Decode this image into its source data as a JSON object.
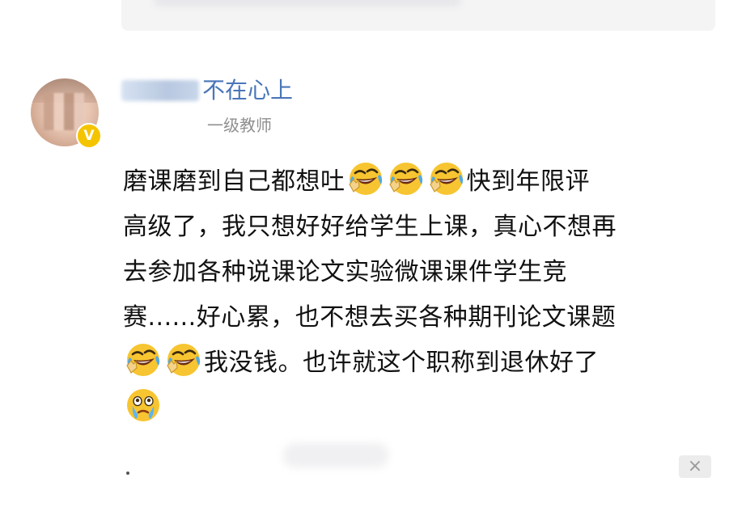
{
  "post": {
    "author": {
      "name_visible": "不在心上",
      "title": "一级教师",
      "verified_badge": "V"
    },
    "lines": [
      [
        "磨课磨到自己都想吐",
        {
          "emoji": "laugh-cry"
        },
        {
          "emoji": "laugh-cry"
        },
        {
          "emoji": "laugh-cry"
        },
        "快到年限评"
      ],
      [
        "高级了，我只想好好给学生上课，真心不想再"
      ],
      [
        "去参加各种说课论文实验微课课件学生竞"
      ],
      [
        "赛......好心累，也不想去买各种期刊论文课题"
      ],
      [
        {
          "emoji": "laugh-cry"
        },
        {
          "emoji": "laugh-cry"
        },
        "我没钱。也许就这个职称到退休好了"
      ],
      [
        {
          "emoji": "crying-face"
        }
      ]
    ]
  },
  "controls": {
    "close_label": "×"
  },
  "colors": {
    "username": "#4a76b8",
    "title_gray": "#8f8f8f",
    "badge_yellow": "#f5c400",
    "text": "#111111"
  }
}
